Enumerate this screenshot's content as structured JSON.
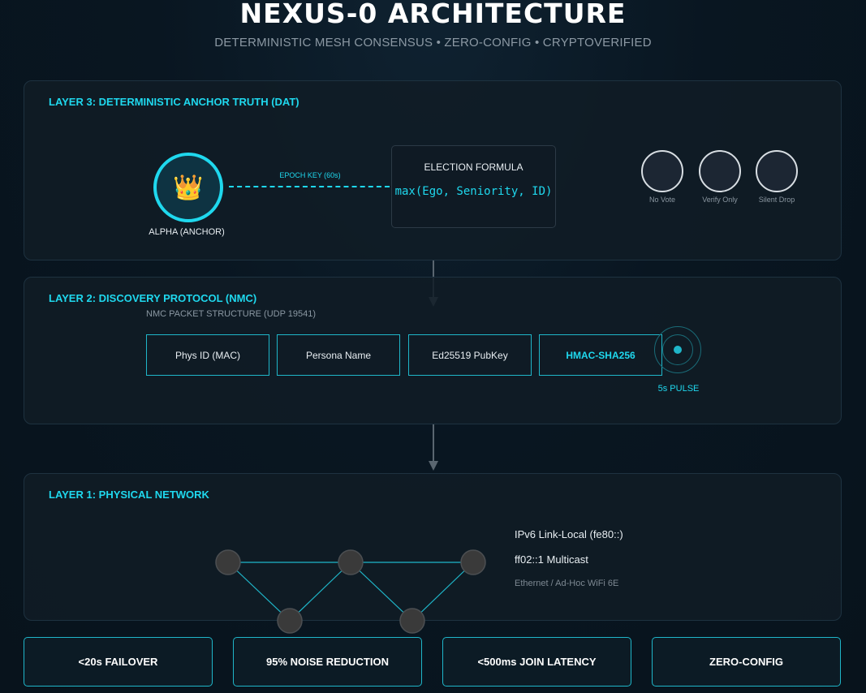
{
  "header": {
    "title": "NEXUS-0 ARCHITECTURE",
    "subtitle": "DETERMINISTIC MESH CONSENSUS • ZERO-CONFIG • CRYPTOVERIFIED"
  },
  "layer3": {
    "title": "LAYER 3: DETERMINISTIC ANCHOR TRUTH (DAT)",
    "anchor_icon": "crown-icon",
    "anchor_glyph": "👑",
    "anchor_label": "ALPHA (ANCHOR)",
    "epoch_label": "EPOCH KEY (60s)",
    "formula_title": "ELECTION FORMULA",
    "formula": "max(Ego, Seniority, ID)",
    "vote_nodes": [
      "No Vote",
      "Verify Only",
      "Silent Drop"
    ]
  },
  "layer2": {
    "title": "LAYER 2: DISCOVERY PROTOCOL (NMC)",
    "packet_caption": "NMC PACKET STRUCTURE (UDP 19541)",
    "packet_fields": [
      "Phys ID (MAC)",
      "Persona Name",
      "Ed25519 PubKey",
      "HMAC-SHA256"
    ],
    "pulse_label": "5s PULSE"
  },
  "layer1": {
    "title": "LAYER 1: PHYSICAL NETWORK",
    "lines": [
      "IPv6 Link-Local (fe80::)",
      "ff02::1 Multicast",
      "Ethernet / Ad-Hoc WiFi 6E"
    ]
  },
  "metrics": [
    "<20s FAILOVER",
    "95% NOISE REDUCTION",
    "<500ms JOIN LATENCY",
    "ZERO-CONFIG"
  ],
  "colors": {
    "accent": "#1fd8ee",
    "background": "#08131c",
    "panel": "#101c26"
  }
}
